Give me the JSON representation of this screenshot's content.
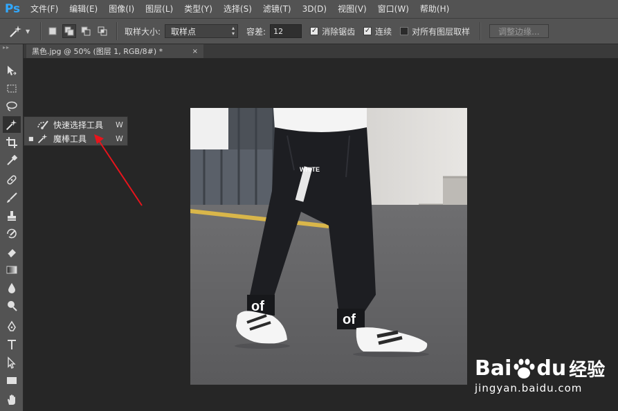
{
  "app": {
    "logo": "Ps"
  },
  "menu": [
    "文件(F)",
    "编辑(E)",
    "图像(I)",
    "图层(L)",
    "类型(Y)",
    "选择(S)",
    "滤镜(T)",
    "3D(D)",
    "视图(V)",
    "窗口(W)",
    "帮助(H)"
  ],
  "options": {
    "sample_size_label": "取样大小:",
    "sample_size_value": "取样点",
    "tolerance_label": "容差:",
    "tolerance_value": "12",
    "antialias_label": "消除锯齿",
    "antialias_checked": true,
    "contiguous_label": "连续",
    "contiguous_checked": true,
    "sample_all_label": "对所有图层取样",
    "sample_all_checked": false,
    "refine_edge_label": "调整边缘..."
  },
  "document": {
    "tab_title": "黑色.jpg @ 50% (图层 1, RGB/8#) *",
    "close_glyph": "×"
  },
  "flyout": {
    "items": [
      {
        "label": "快速选择工具",
        "shortcut": "W",
        "icon": "quick-selection-icon",
        "selected": false
      },
      {
        "label": "魔棒工具",
        "shortcut": "W",
        "icon": "magic-wand-icon",
        "selected": true
      }
    ]
  },
  "tools": [
    "move-icon",
    "marquee-icon",
    "lasso-icon",
    "magic-wand-icon",
    "crop-icon",
    "eyedropper-icon",
    "healing-brush-icon",
    "brush-icon",
    "clone-stamp-icon",
    "history-brush-icon",
    "eraser-icon",
    "gradient-icon",
    "blur-icon",
    "dodge-icon",
    "pen-icon",
    "type-icon",
    "path-selection-icon",
    "rectangle-icon",
    "hand-icon"
  ],
  "photo": {
    "logo_text": "of",
    "pants_text": "WHITE"
  },
  "watermark": {
    "brand": "Bai",
    "brand2": "du",
    "site_label": "经验",
    "url": "jingyan.baidu.com"
  },
  "colors": {
    "accent": "#31a8ff",
    "annotation": "#e8141c",
    "panel": "#535353",
    "workspace": "#262626"
  }
}
